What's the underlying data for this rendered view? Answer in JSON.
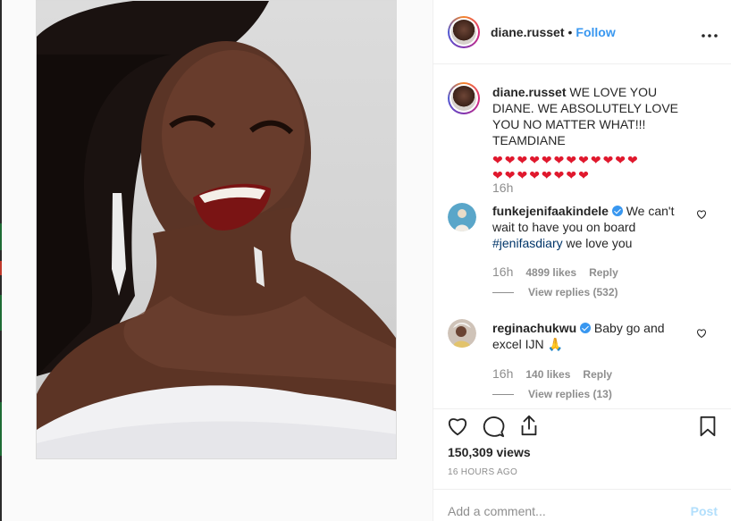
{
  "post": {
    "author": "diane.russet",
    "follow_label": "Follow",
    "separator": "•",
    "more_label": "•••"
  },
  "caption": {
    "username": "diane.russet",
    "text": "WE LOVE YOU DIANE. WE ABSOLUTELY LOVE YOU NO MATTER WHAT!!! TEAMDIANE",
    "hearts_line1": "❤❤❤❤❤❤❤❤❤❤❤❤",
    "hearts_line2": "❤❤❤❤❤❤❤❤",
    "time": "16h"
  },
  "comments": [
    {
      "username": "funkejenifaakindele",
      "verified": true,
      "text_before": "We can't wait to have you on board",
      "hashtag": "#jenifasdiary",
      "text_after": " we love you",
      "time": "16h",
      "likes": "4899 likes",
      "reply_label": "Reply",
      "view_replies": "View replies (532)"
    },
    {
      "username": "reginachukwu",
      "verified": true,
      "text_before": "Baby go and excel IJN 🙏",
      "time": "16h",
      "likes": "140 likes",
      "reply_label": "Reply",
      "view_replies": "View replies (13)"
    }
  ],
  "stats": {
    "views": "150,309 views",
    "time_ago": "16 HOURS AGO"
  },
  "composer": {
    "placeholder": "Add a comment...",
    "post_label": "Post"
  },
  "icons": {
    "like": "heart-icon",
    "comment": "comment-icon",
    "share": "share-icon",
    "save": "bookmark-icon",
    "more": "more-options-icon"
  },
  "colors": {
    "link": "#3897f0",
    "muted": "#8e8e8e",
    "heart": "#e0182d",
    "post_disabled": "#b2dffc"
  }
}
